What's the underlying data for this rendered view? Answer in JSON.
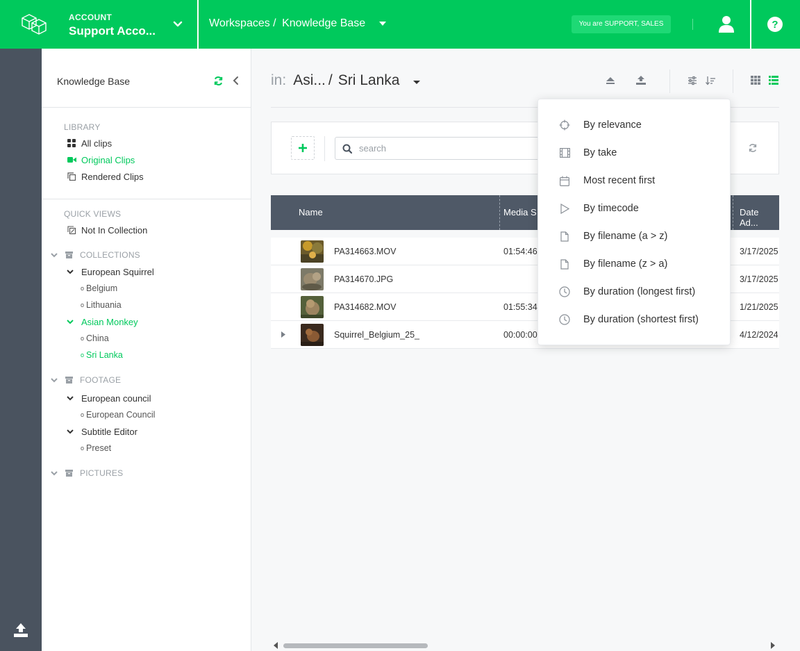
{
  "topbar": {
    "account_label": "ACCOUNT",
    "account_name": "Support Acco...",
    "breadcrumb": [
      "Workspaces /",
      "Knowledge Base"
    ],
    "role_badge": "You are SUPPORT, SALES",
    "brand_color": "#00c95c"
  },
  "sidebar": {
    "title": "Knowledge Base",
    "library": {
      "heading": "LIBRARY",
      "items": [
        {
          "label": "All clips",
          "icon": "grid-icon"
        },
        {
          "label": "Original Clips",
          "icon": "video-camera-icon",
          "active": true
        },
        {
          "label": "Rendered Clips",
          "icon": "copy-icon"
        }
      ]
    },
    "quick_views": {
      "heading": "QUICK VIEWS",
      "items": [
        {
          "label": "Not In Collection",
          "icon": "collection-off-icon"
        }
      ]
    },
    "collections": {
      "heading": "COLLECTIONS",
      "groups": [
        {
          "label": "European Squirrel",
          "children": [
            "Belgium",
            "Lithuania"
          ]
        },
        {
          "label": "Asian Monkey",
          "active": true,
          "children": [
            "China",
            "Sri Lanka"
          ],
          "active_child": 1
        }
      ]
    },
    "footage": {
      "heading": "FOOTAGE",
      "groups": [
        {
          "label": "European council",
          "children": [
            "European Council"
          ]
        },
        {
          "label": "Subtitle Editor",
          "children": [
            "Preset"
          ]
        }
      ]
    },
    "pictures": {
      "heading": "PICTURES"
    }
  },
  "main": {
    "path": {
      "in_label": "in:",
      "parent": "Asi...",
      "current": "Sri Lanka"
    },
    "search": {
      "placeholder": "search",
      "value": ""
    },
    "table": {
      "columns": [
        "Name",
        "Media S",
        "Date Ad..."
      ],
      "rows": [
        {
          "name": "PA314663.MOV",
          "media": "01:54:46",
          "date": "3/17/2025"
        },
        {
          "name": "PA314670.JPG",
          "media": "",
          "date": "3/17/2025"
        },
        {
          "name": "PA314682.MOV",
          "media": "01:55:34:",
          "date": "1/21/2025"
        },
        {
          "name": "Squirrel_Belgium_25_",
          "media": "00:00:00",
          "date": "4/12/2024"
        }
      ]
    }
  },
  "sort_menu": {
    "items": [
      {
        "label": "By relevance",
        "icon": "crosshair-icon"
      },
      {
        "label": "By take",
        "icon": "film-icon"
      },
      {
        "label": "Most recent first",
        "icon": "calendar-icon"
      },
      {
        "label": "By timecode",
        "icon": "play-icon"
      },
      {
        "label": "By filename (a > z)",
        "icon": "file-icon"
      },
      {
        "label": "By filename (z > a)",
        "icon": "file-icon"
      },
      {
        "label": "By duration (longest first)",
        "icon": "clock-icon"
      },
      {
        "label": "By duration (shortest first)",
        "icon": "clock-icon"
      }
    ]
  }
}
